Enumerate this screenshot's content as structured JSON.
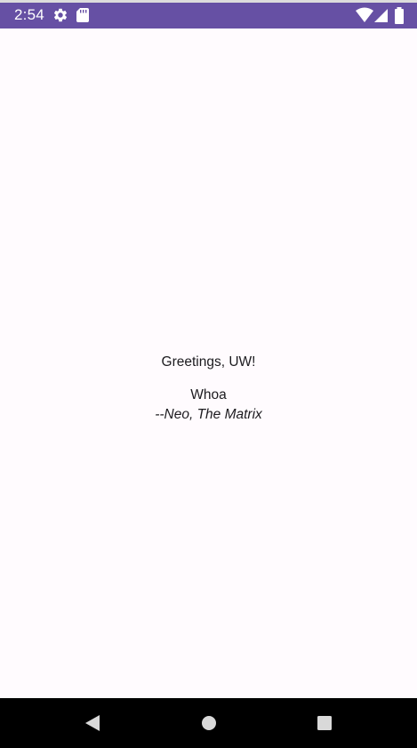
{
  "status_bar": {
    "time": "2:54",
    "icons": [
      "gear-icon",
      "sd-card-icon",
      "wifi-icon",
      "cell-signal-icon",
      "battery-icon"
    ],
    "background_color": "#6650a4"
  },
  "main": {
    "greeting": "Greetings, UW!",
    "quote": "Whoa",
    "attribution": "--Neo, The Matrix"
  },
  "nav_bar": {
    "buttons": [
      "back-icon",
      "home-icon",
      "recents-icon"
    ]
  }
}
